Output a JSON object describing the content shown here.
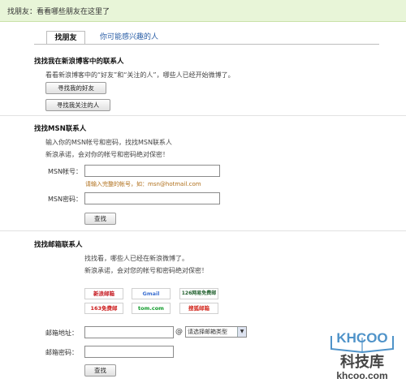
{
  "topbar": {
    "text": "找朋友：看看哪些朋友在这里了"
  },
  "tabs": [
    {
      "label": "找朋友"
    },
    {
      "label": "你可能感兴趣的人"
    }
  ],
  "sina": {
    "title": "找找我在新浪博客中的联系人",
    "desc": "看看新浪博客中的“好友”和“关注的人”，哪些人已经开始微博了。",
    "btn_friends": "寻找我的好友",
    "btn_following": "寻找我关注的人"
  },
  "msn": {
    "title": "找找MSN联系人",
    "desc1": "输入你的MSN帐号和密码，找找MSN联系人",
    "desc2": "新浪承诺，会对你的帐号和密码绝对保密！",
    "account_label": "MSN帐号：",
    "hint": "请输入完整的帐号，如：msn@hotmail.com",
    "password_label": "MSN密码：",
    "search": "查找"
  },
  "mail": {
    "title": "找找邮箱联系人",
    "desc1": "找找看，哪些人已经在新浪微博了。",
    "desc2": "新浪承诺，会对您的帐号和密码绝对保密！",
    "providers": [
      "新浪邮箱",
      "Gmail",
      "126网易免费邮",
      "163免费邮",
      "tom.com",
      "搜狐邮箱"
    ],
    "address_label": "邮箱地址：",
    "at": "@",
    "select_placeholder": "请选择邮箱类型",
    "password_label": "邮箱密码：",
    "search": "查找"
  },
  "watermark": {
    "logo": "KHCOO",
    "cn": "科技库",
    "url": "khcoo.com"
  },
  "colors": {
    "topbar_bg": "#e8f5d8",
    "tab_link": "#2a5ea6",
    "hint": "#b0701c",
    "watermark": "#4f93c9"
  }
}
